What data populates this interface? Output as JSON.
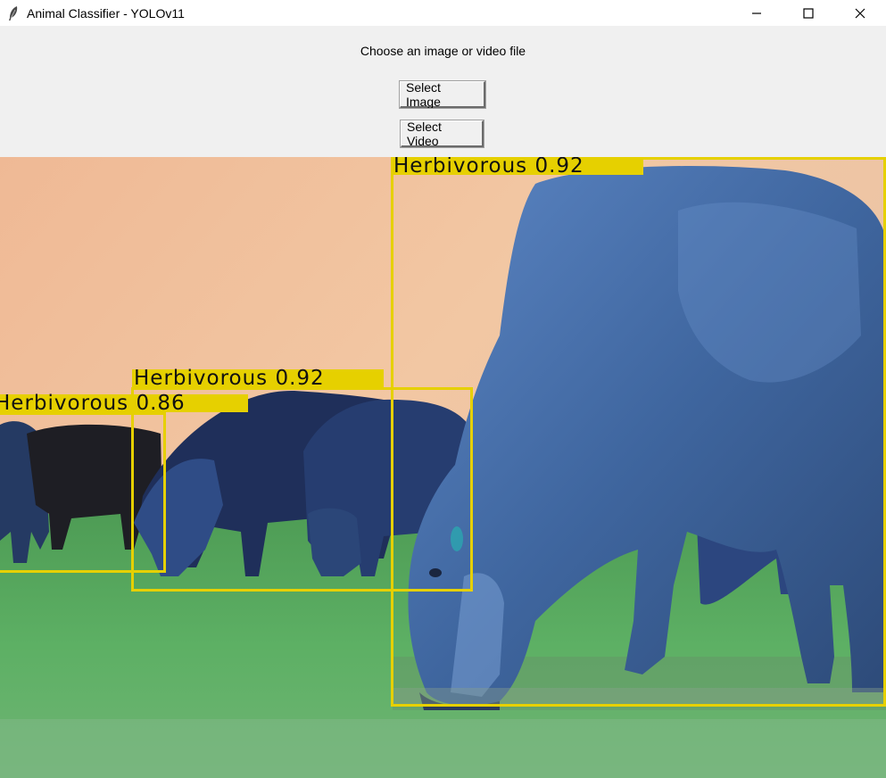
{
  "window": {
    "title": "Animal Classifier - YOLOv11",
    "icon": "feather-icon",
    "controls": [
      "minimize-icon",
      "maximize-icon",
      "close-icon"
    ]
  },
  "controls": {
    "prompt": "Choose an image or video file",
    "select_image_label": "Select Image",
    "select_video_label": "Select Video"
  },
  "detections": [
    {
      "label": "Herbivorous 0.92",
      "class": "Herbivorous",
      "confidence": 0.92
    },
    {
      "label": "Herbivorous 0.92",
      "class": "Herbivorous",
      "confidence": 0.92
    },
    {
      "label": "Herbivorous 0.86",
      "class": "Herbivorous",
      "confidence": 0.86
    }
  ],
  "colors": {
    "box": "#e6d000",
    "sky_top": "#f2c09a",
    "grass": "#5aa85a",
    "cattle": "#3a5a9a"
  }
}
